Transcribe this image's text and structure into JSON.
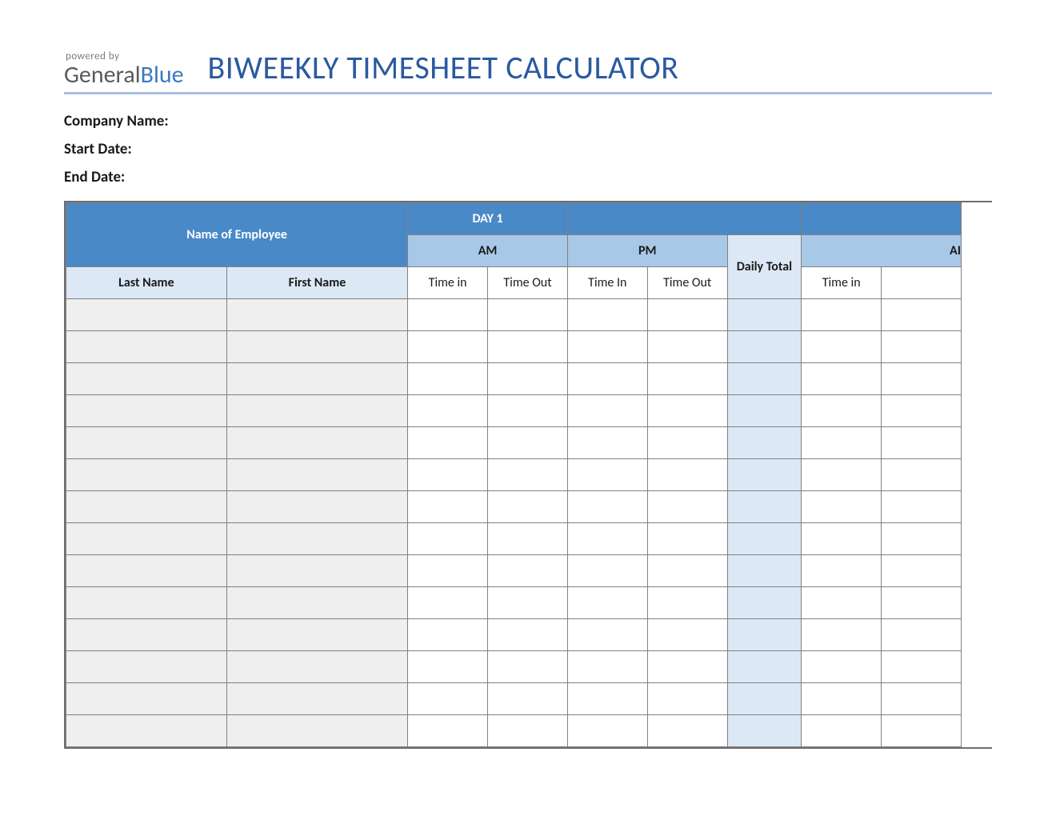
{
  "logo": {
    "powered_by": "powered by",
    "brand_part1": "General",
    "brand_part2": "Blue"
  },
  "title": "BIWEEKLY TIMESHEET CALCULATOR",
  "meta": {
    "company_label": "Company Name:",
    "start_label": "Start Date:",
    "end_label": "End Date:"
  },
  "table": {
    "employee_header": "Name of Employee",
    "day1_header": "DAY 1",
    "day2_header": "",
    "am_header": "AM",
    "pm_header": "PM",
    "daily_total_header": "Daily Total",
    "am2_header_partial": "AI",
    "last_name_header": "Last Name",
    "first_name_header": "First Name",
    "time_in_header": "Time in",
    "time_out_header": "Time Out",
    "time_in2_header": "Time In",
    "time_out2_header": "Time Out",
    "time_in3_header": "Time in",
    "row_count": 14
  },
  "colors": {
    "header_blue": "#4a89c8",
    "light_blue": "#a8c8e8",
    "pale_blue": "#dce8f5",
    "title_blue": "#2a5aa0"
  }
}
